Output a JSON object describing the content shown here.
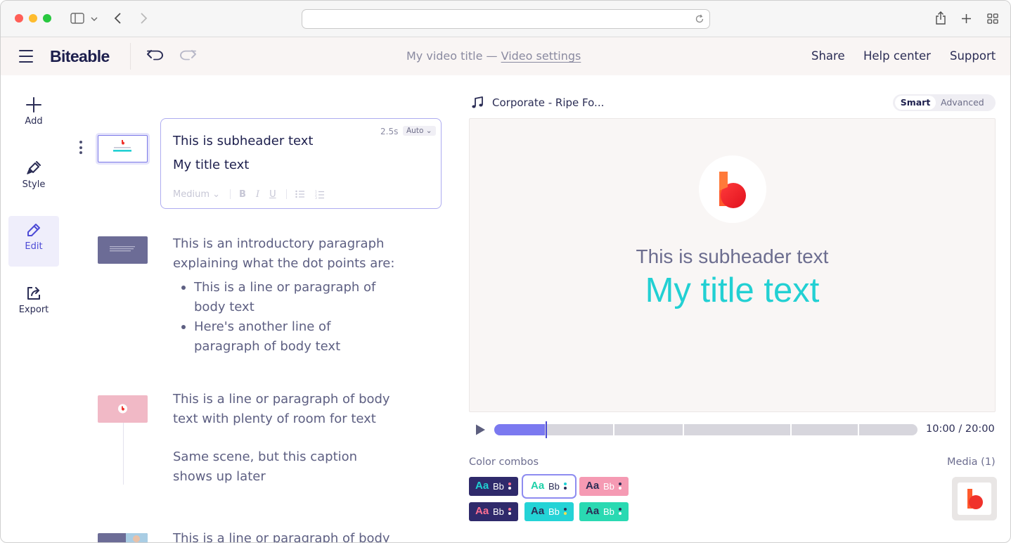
{
  "app": {
    "brand": "Biteable"
  },
  "header": {
    "video_title": "My video title — ",
    "video_settings": "Video settings",
    "links": [
      "Share",
      "Help center",
      "Support"
    ]
  },
  "rail": {
    "items": [
      {
        "label": "Add",
        "icon": "plus-icon",
        "active": false
      },
      {
        "label": "Style",
        "icon": "brush-icon",
        "active": false
      },
      {
        "label": "Edit",
        "icon": "pencil-icon",
        "active": true
      },
      {
        "label": "Export",
        "icon": "export-icon",
        "active": false
      }
    ]
  },
  "scenes": {
    "card": {
      "duration": "2.5s",
      "auto": "Auto",
      "subheader": "This is subheader text",
      "title": "My title text",
      "text_size": "Medium",
      "toolbar_icons": [
        "bold-icon",
        "italic-icon",
        "underline-icon",
        "bullet-list-icon",
        "numbered-list-icon"
      ]
    },
    "scene2": {
      "line1": "This is an introductory paragraph",
      "line2": "explaining what the dot points are:",
      "bullets": [
        {
          "l1": "This is a line or paragraph of",
          "l2": "body text"
        },
        {
          "l1": "Here's another line of",
          "l2": "paragraph of body text"
        }
      ]
    },
    "scene3": {
      "line1": "This is a line or paragraph of body",
      "line2": "text with plenty of room for text",
      "line3": "Same scene, but this caption",
      "line4": "shows up later"
    },
    "scene4": {
      "line1": "This is a line or paragraph of body"
    }
  },
  "music": {
    "track": "Corporate - Ripe Fo..."
  },
  "mode_toggle": {
    "smart": "Smart",
    "advanced": "Advanced",
    "selected": "Smart"
  },
  "preview": {
    "subheader": "This is subheader text",
    "title": "My title text",
    "title_color": "#22d0d3"
  },
  "timeline": {
    "time": "10:00 / 20:00",
    "progress": 0.12
  },
  "colors": {
    "label": "Color combos",
    "aa": "Aa",
    "bb": "Bb",
    "combos": [
      {
        "bg": "#2f2a6b",
        "aa": "#1ed1d4",
        "bb": "#ffffff",
        "dots": [
          "#ff6f91",
          "#ffffff"
        ]
      },
      {
        "bg": "#ffffff",
        "aa": "#1ed1a8",
        "bb": "#2b2d55",
        "dots": [
          "#1ed1d4",
          "#2b2d55"
        ],
        "selected": true
      },
      {
        "bg": "#f59ab3",
        "aa": "#2b2d55",
        "bb": "#ffffff",
        "dots": [
          "#2b2d55",
          "#ffffff"
        ]
      },
      {
        "bg": "#2f2a6b",
        "aa": "#ff6f91",
        "bb": "#ffffff",
        "dots": [
          "#ff6f91",
          "#ffffff"
        ]
      },
      {
        "bg": "#24d3d6",
        "aa": "#2b2d55",
        "bb": "#ffffff",
        "dots": [
          "#2b2d55",
          "#f5e04c"
        ]
      },
      {
        "bg": "#2ad9b2",
        "aa": "#2b2d55",
        "bb": "#ffffff",
        "dots": [
          "#2b2d55",
          "#ffffff"
        ]
      }
    ]
  },
  "media": {
    "label": "Media (1)"
  }
}
